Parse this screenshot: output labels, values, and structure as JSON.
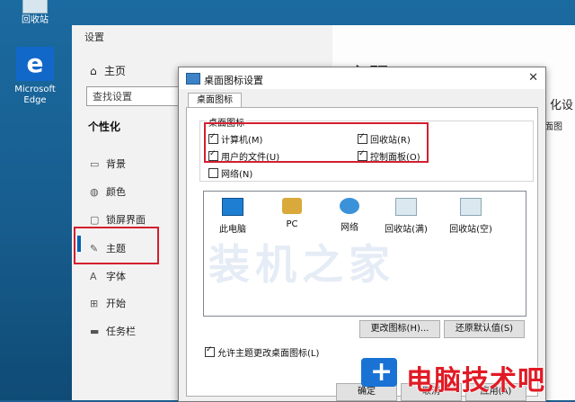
{
  "desktop": {
    "recycle_label": "回收站",
    "edge_label_1": "Microsoft",
    "edge_label_2": "Edge",
    "edge_glyph": "e"
  },
  "settings": {
    "title": "设置",
    "home": "主页",
    "search_placeholder": "查找设置",
    "section": "个性化",
    "nav": [
      {
        "label": "背景",
        "icon": "picture-icon"
      },
      {
        "label": "颜色",
        "icon": "palette-icon"
      },
      {
        "label": "锁屏界面",
        "icon": "lock-screen-icon"
      },
      {
        "label": "主题",
        "icon": "theme-icon"
      },
      {
        "label": "字体",
        "icon": "font-icon"
      },
      {
        "label": "开始",
        "icon": "start-icon"
      },
      {
        "label": "任务栏",
        "icon": "taskbar-icon"
      }
    ],
    "right_title": "主题",
    "right_sub": "化设",
    "right_sub2": "面图"
  },
  "dialog": {
    "title": "桌面图标设置",
    "tab": "桌面图标",
    "group_label": "桌面图标",
    "checkboxes": [
      {
        "label": "计算机(M)",
        "checked": true
      },
      {
        "label": "回收站(R)",
        "checked": true
      },
      {
        "label": "用户的文件(U)",
        "checked": true
      },
      {
        "label": "控制面板(O)",
        "checked": true
      },
      {
        "label": "网络(N)",
        "checked": false
      }
    ],
    "icons": [
      {
        "label": "此电脑"
      },
      {
        "label": "PC"
      },
      {
        "label": "网络"
      },
      {
        "label": "回收站(满)"
      },
      {
        "label": "回收站(空)"
      }
    ],
    "watermark": "装机之家",
    "change_icon": "更改图标(H)...",
    "restore": "还原默认值(S)",
    "allow_theme": "允许主题更改桌面图标(L)",
    "ok": "确定",
    "cancel": "取消",
    "apply": "应用(A)"
  },
  "brand": {
    "text": "电脑技术吧"
  },
  "colors": {
    "highlight_red": "#d2202f",
    "accent_blue": "#0063b1",
    "brand_red": "#e11a25"
  }
}
